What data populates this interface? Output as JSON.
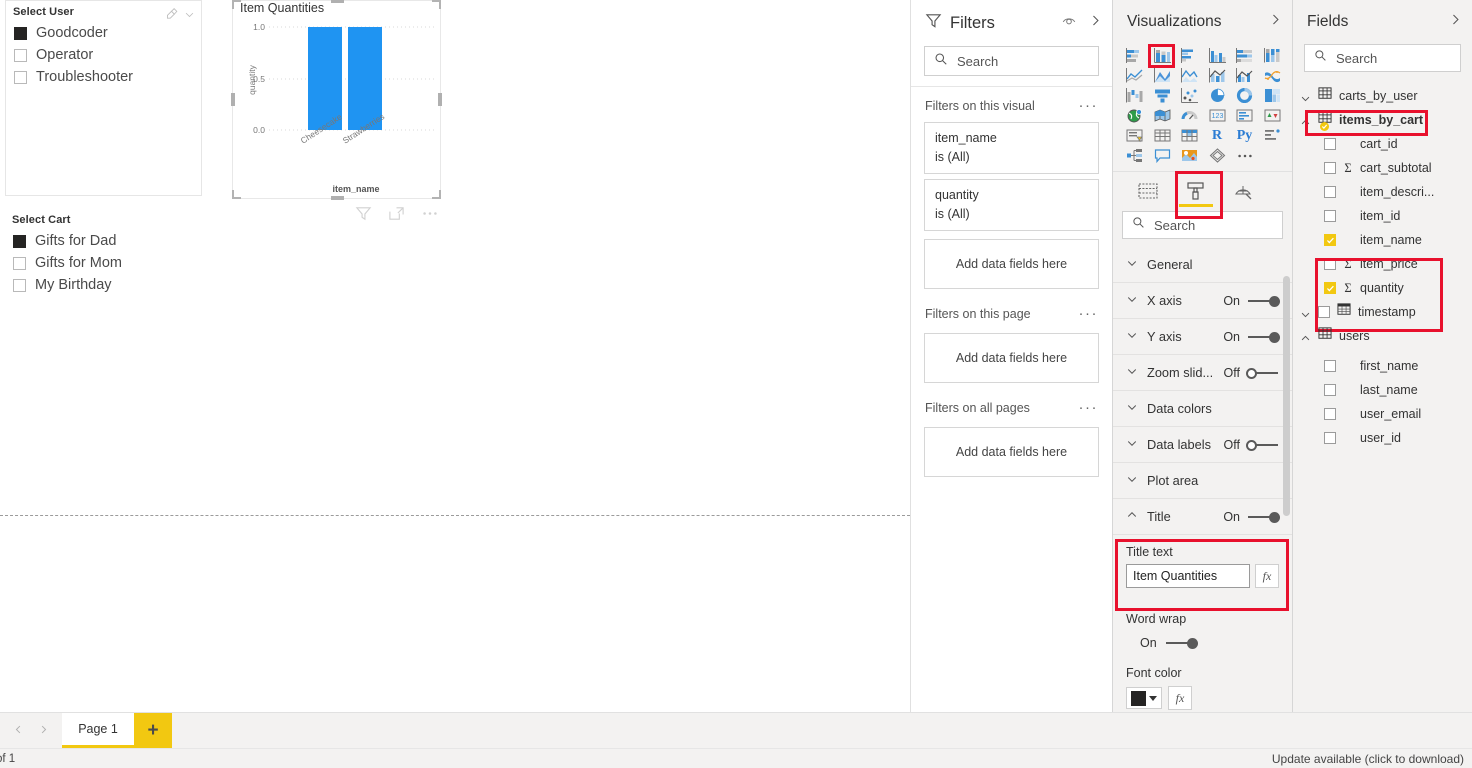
{
  "canvas": {
    "slicer_user": {
      "title": "Select User",
      "eraser_icon": "eraser-icon",
      "chevron_icon": "chevron-down-icon",
      "items": [
        {
          "label": "Goodcoder",
          "checked": true
        },
        {
          "label": "Operator",
          "checked": false
        },
        {
          "label": "Troubleshooter",
          "checked": false
        }
      ]
    },
    "slicer_cart": {
      "title": "Select Cart",
      "items": [
        {
          "label": "Gifts for Dad",
          "checked": true
        },
        {
          "label": "Gifts for Mom",
          "checked": false
        },
        {
          "label": "My Birthday",
          "checked": false
        }
      ]
    },
    "visual": {
      "title": "Item Quantities",
      "tools": [
        "filter-icon",
        "focus-mode-icon",
        "more-options-icon"
      ]
    }
  },
  "chart_data": {
    "type": "bar",
    "title": "Item Quantities",
    "categories": [
      "Cheesecake",
      "Strawberries"
    ],
    "values": [
      1.0,
      1.0
    ],
    "series": [
      {
        "name": "quantity",
        "values": [
          1.0,
          1.0
        ]
      }
    ],
    "xlabel": "item_name",
    "ylabel": "quantity",
    "yticks": [
      "0.0",
      "0.5",
      "1.0"
    ],
    "ylim": [
      0,
      1
    ],
    "grid": true,
    "legend": "none",
    "bar_color": "#1F94F2"
  },
  "filters": {
    "title": "Filters",
    "eye_icon": "hide-filters-icon",
    "collapse_icon": "chevron-right-icon",
    "search_placeholder": "Search",
    "search_icon": "search-icon",
    "groups": [
      {
        "title": "Filters on this visual",
        "menu": "···",
        "cards": [
          {
            "field": "item_name",
            "condition": "is (All)"
          },
          {
            "field": "quantity",
            "condition": "is (All)"
          }
        ],
        "dropzone": "Add data fields here"
      },
      {
        "title": "Filters on this page",
        "menu": "···",
        "cards": [],
        "dropzone": "Add data fields here"
      },
      {
        "title": "Filters on all pages",
        "menu": "···",
        "cards": [],
        "dropzone": "Add data fields here"
      }
    ]
  },
  "visualizations": {
    "title": "Visualizations",
    "collapse_icon": "chevron-right-icon",
    "icons": [
      {
        "name": "stacked-bar-chart-icon",
        "selected": false
      },
      {
        "name": "stacked-column-chart-icon",
        "selected": true
      },
      {
        "name": "clustered-bar-chart-icon",
        "selected": false
      },
      {
        "name": "clustered-column-chart-icon",
        "selected": false
      },
      {
        "name": "100-stacked-bar-chart-icon",
        "selected": false
      },
      {
        "name": "100-stacked-column-chart-icon",
        "selected": false
      },
      {
        "name": "line-chart-icon",
        "selected": false
      },
      {
        "name": "area-chart-icon",
        "selected": false
      },
      {
        "name": "stacked-area-chart-icon",
        "selected": false
      },
      {
        "name": "line-and-stacked-column-chart-icon",
        "selected": false
      },
      {
        "name": "line-and-clustered-column-chart-icon",
        "selected": false
      },
      {
        "name": "ribbon-chart-icon",
        "selected": false
      },
      {
        "name": "waterfall-chart-icon",
        "selected": false
      },
      {
        "name": "funnel-chart-icon",
        "selected": false
      },
      {
        "name": "scatter-chart-icon",
        "selected": false
      },
      {
        "name": "pie-chart-icon",
        "selected": false
      },
      {
        "name": "donut-chart-icon",
        "selected": false
      },
      {
        "name": "treemap-icon",
        "selected": false
      },
      {
        "name": "map-icon",
        "selected": false
      },
      {
        "name": "filled-map-icon",
        "selected": false
      },
      {
        "name": "gauge-icon",
        "selected": false
      },
      {
        "name": "card-icon",
        "selected": false
      },
      {
        "name": "multi-row-card-icon",
        "selected": false
      },
      {
        "name": "kpi-icon",
        "selected": false
      },
      {
        "name": "slicer-icon",
        "selected": false
      },
      {
        "name": "table-icon",
        "selected": false
      },
      {
        "name": "matrix-icon",
        "selected": false
      },
      {
        "name": "r-script-visual-icon",
        "selected": false,
        "text": "R"
      },
      {
        "name": "python-visual-icon",
        "selected": false,
        "text": "Py"
      },
      {
        "name": "key-influencers-icon",
        "selected": false
      },
      {
        "name": "decomposition-tree-icon",
        "selected": false
      },
      {
        "name": "qna-visual-icon",
        "selected": false
      },
      {
        "name": "arcgis-maps-icon",
        "selected": false
      },
      {
        "name": "paginated-report-icon",
        "selected": false
      },
      {
        "name": "more-visuals-icon",
        "selected": false,
        "text": "···"
      }
    ],
    "tabs": [
      {
        "name": "fields-tab",
        "active": false,
        "boxed": false
      },
      {
        "name": "format-tab",
        "active": true,
        "boxed": true
      },
      {
        "name": "analytics-tab",
        "active": false,
        "boxed": false
      }
    ],
    "search_placeholder": "Search",
    "search_icon": "search-icon",
    "format_rows": [
      {
        "label": "General",
        "toggle": null
      },
      {
        "label": "X axis",
        "toggle": "On"
      },
      {
        "label": "Y axis",
        "toggle": "On"
      },
      {
        "label": "Zoom slid...",
        "toggle": "Off"
      },
      {
        "label": "Data colors",
        "toggle": null
      },
      {
        "label": "Data labels",
        "toggle": "Off"
      },
      {
        "label": "Plot area",
        "toggle": null
      },
      {
        "label": "Title",
        "toggle": "On",
        "expanded": true
      }
    ],
    "title_section": {
      "title_text_label": "Title text",
      "title_text_value": "Item Quantities",
      "fx_label": "fx",
      "word_wrap_label": "Word wrap",
      "word_wrap_state": "On",
      "font_color_label": "Font color",
      "font_color_value": "#252423",
      "highlight_color": "#E8112D"
    }
  },
  "fields": {
    "title": "Fields",
    "collapse_icon": "chevron-right-icon",
    "search_placeholder": "Search",
    "search_icon": "search-icon",
    "tree": [
      {
        "type": "table",
        "label": "carts_by_user",
        "expanded": true,
        "chevron": "chevron-down-icon",
        "icon": "table-icon",
        "checked": false,
        "bold": false
      },
      {
        "type": "table",
        "label": "items_by_cart",
        "expanded": false,
        "chevron": "chevron-up-icon",
        "icon": "table-with-badge-icon",
        "checked": true,
        "bold": true,
        "highlighted": true
      },
      {
        "type": "field",
        "label": "cart_id",
        "checked": false,
        "aggregate": false
      },
      {
        "type": "field",
        "label": "cart_subtotal",
        "checked": false,
        "aggregate": true
      },
      {
        "type": "field",
        "label": "item_descri...",
        "checked": false,
        "aggregate": false
      },
      {
        "type": "field",
        "label": "item_id",
        "checked": false,
        "aggregate": false
      },
      {
        "type": "field",
        "label": "item_name",
        "checked": true,
        "aggregate": false
      },
      {
        "type": "field",
        "label": "item_price",
        "checked": false,
        "aggregate": true
      },
      {
        "type": "field",
        "label": "quantity",
        "checked": true,
        "aggregate": true
      },
      {
        "type": "table",
        "label": "timestamp",
        "expanded": true,
        "chevron": "chevron-down-icon",
        "icon": "date-table-icon",
        "checked": false,
        "bold": false,
        "indented": true
      },
      {
        "type": "table",
        "label": "users",
        "expanded": false,
        "chevron": "chevron-up-icon",
        "icon": "table-icon",
        "checked": false,
        "bold": false
      },
      {
        "type": "field",
        "label": "first_name",
        "checked": false,
        "aggregate": false
      },
      {
        "type": "field",
        "label": "last_name",
        "checked": false,
        "aggregate": false
      },
      {
        "type": "field",
        "label": "user_email",
        "checked": false,
        "aggregate": false
      },
      {
        "type": "field",
        "label": "user_id",
        "checked": false,
        "aggregate": false
      }
    ]
  },
  "pagebar": {
    "prev_icon": "chevron-left-icon",
    "next_icon": "chevron-right-icon",
    "tabs": [
      {
        "label": "Page 1",
        "active": true
      }
    ],
    "add_label": "+"
  },
  "statusbar": {
    "left_text": "of 1",
    "right_text": "Update available (click to download)"
  }
}
